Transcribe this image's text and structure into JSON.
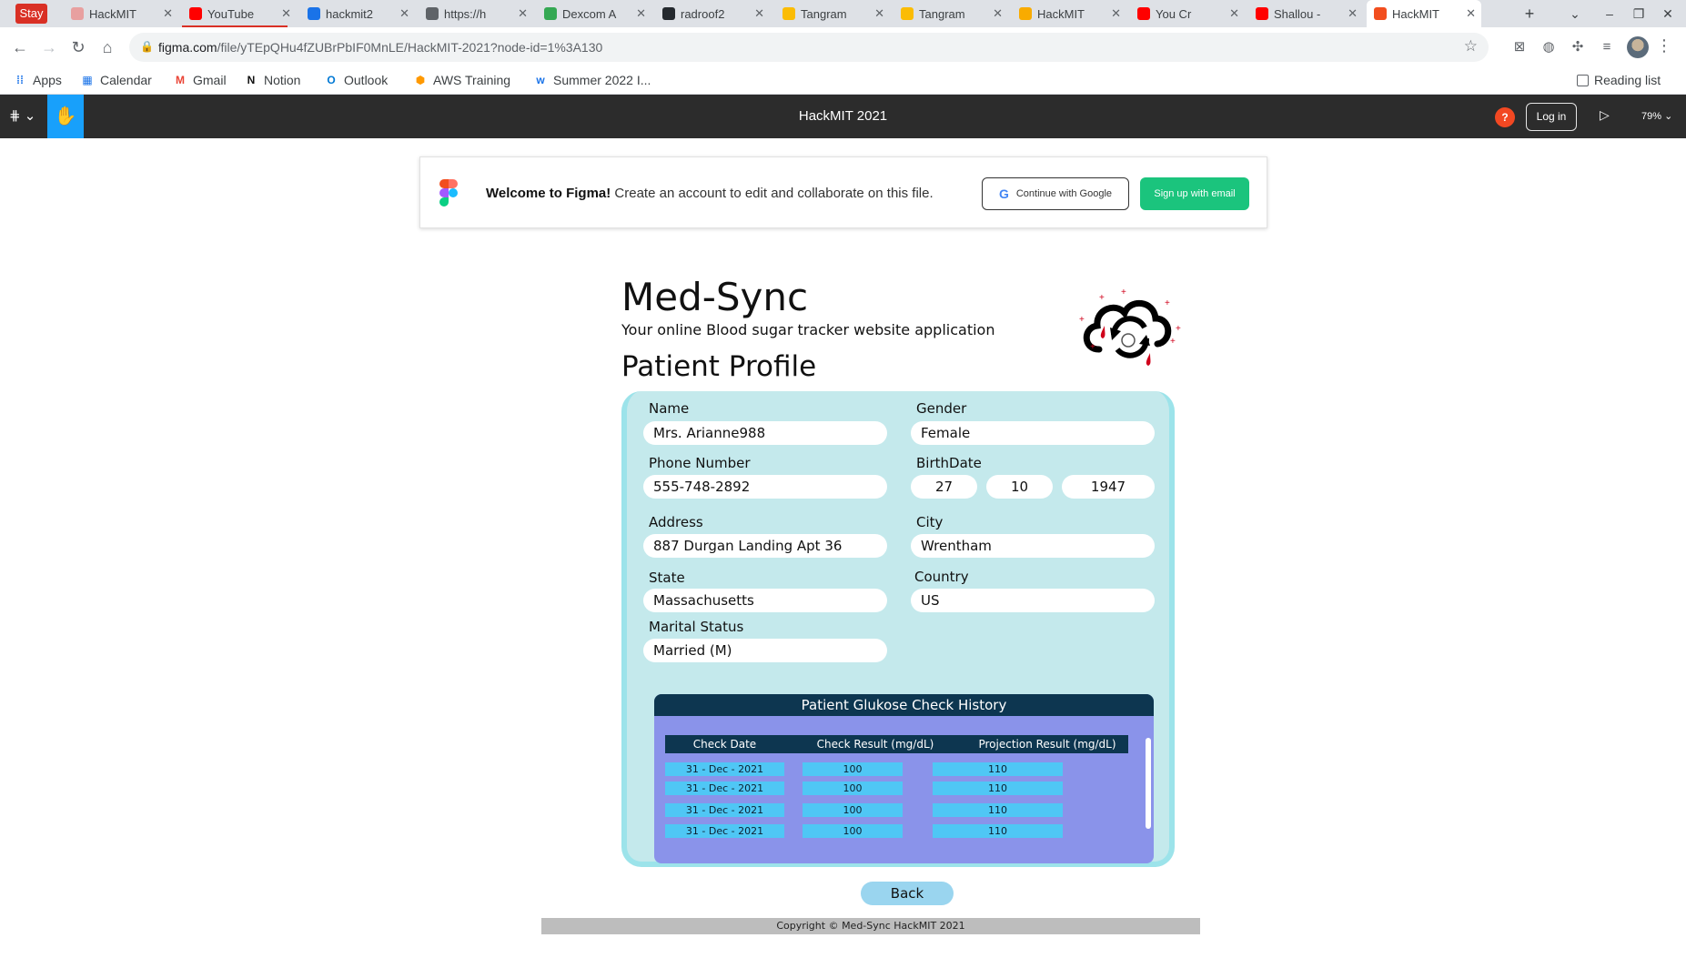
{
  "browser": {
    "stay_label": "Stay",
    "tabs": [
      {
        "title": "HackMIT",
        "color": "#e8a0a0"
      },
      {
        "title": "YouTube",
        "color": "#ff0000"
      },
      {
        "title": "hackmit2",
        "color": "#1a73e8"
      },
      {
        "title": "https://h",
        "color": "#5f6368"
      },
      {
        "title": "Dexcom A",
        "color": "#34a853"
      },
      {
        "title": "radroof2",
        "color": "#24292e"
      },
      {
        "title": "Tangram",
        "color": "#fbbc04"
      },
      {
        "title": "Tangram",
        "color": "#fbbc04"
      },
      {
        "title": "HackMIT",
        "color": "#f9ab00"
      },
      {
        "title": "You Cr",
        "color": "#ff0000"
      },
      {
        "title": "Shallou -",
        "color": "#ff0000"
      },
      {
        "title": "HackMIT",
        "color": "#f24e1e"
      }
    ],
    "new_tab": "+",
    "url_host": "figma.com",
    "url_path": "/file/yTEpQHu4fZUBrPbIF0MnLE/HackMIT-2021?node-id=1%3A130",
    "bookmarks": [
      {
        "label": "Apps",
        "icon": "apps-grid-icon"
      },
      {
        "label": "Calendar",
        "icon": "calendar-icon"
      },
      {
        "label": "Gmail",
        "icon": "gmail-icon"
      },
      {
        "label": "Notion",
        "icon": "notion-icon"
      },
      {
        "label": "Outlook",
        "icon": "outlook-icon"
      },
      {
        "label": "AWS Training",
        "icon": "aws-icon"
      },
      {
        "label": "Summer 2022 I...",
        "icon": "w-icon"
      }
    ],
    "reading_list": "Reading list"
  },
  "figma": {
    "file_title": "HackMIT 2021",
    "help": "?",
    "login": "Log in",
    "zoom": "79%",
    "banner": {
      "welcome_bold": "Welcome to Figma!",
      "welcome_rest": " Create an account to edit and collaborate on this file.",
      "google_label": "Continue with Google",
      "email_label": "Sign up with email"
    }
  },
  "app": {
    "title": "Med-Sync",
    "subtitle": "Your online Blood sugar tracker website application",
    "page_title": "Patient Profile",
    "fields": {
      "name": {
        "label": "Name",
        "value": "Mrs. Arianne988"
      },
      "gender": {
        "label": "Gender",
        "value": "Female"
      },
      "phone": {
        "label": "Phone Number",
        "value": "555-748-2892"
      },
      "birthdate": {
        "label": "BirthDate",
        "day": "27",
        "month": "10",
        "year": "1947"
      },
      "address": {
        "label": "Address",
        "value": "887 Durgan Landing Apt 36"
      },
      "city": {
        "label": "City",
        "value": "Wrentham"
      },
      "state": {
        "label": "State",
        "value": "Massachusetts"
      },
      "country": {
        "label": "Country",
        "value": "US"
      },
      "marital": {
        "label": "Marital Status",
        "value": "Married (M)"
      }
    },
    "history": {
      "title": "Patient Glukose Check History",
      "columns": [
        "Check Date",
        "Check Result (mg/dL)",
        "Projection Result (mg/dL)"
      ],
      "rows": [
        [
          "31 - Dec - 2021",
          "100",
          "110"
        ],
        [
          "31 - Dec - 2021",
          "100",
          "110"
        ],
        [
          "31 - Dec - 2021",
          "100",
          "110"
        ],
        [
          "31 - Dec - 2021",
          "100",
          "110"
        ]
      ]
    },
    "back_label": "Back",
    "footer": "Copyright © Med-Sync HackMIT 2021"
  },
  "colors": {
    "figma_toolbar": "#2c2c2c",
    "figma_blue": "#18a0fb",
    "signup_green": "#1bc47d",
    "card_bg": "#c4e9ec",
    "history_bg": "#8a93ea",
    "table_header": "#0d3650",
    "table_cell": "#4fc7f5",
    "back_button": "#9ad5ef"
  }
}
